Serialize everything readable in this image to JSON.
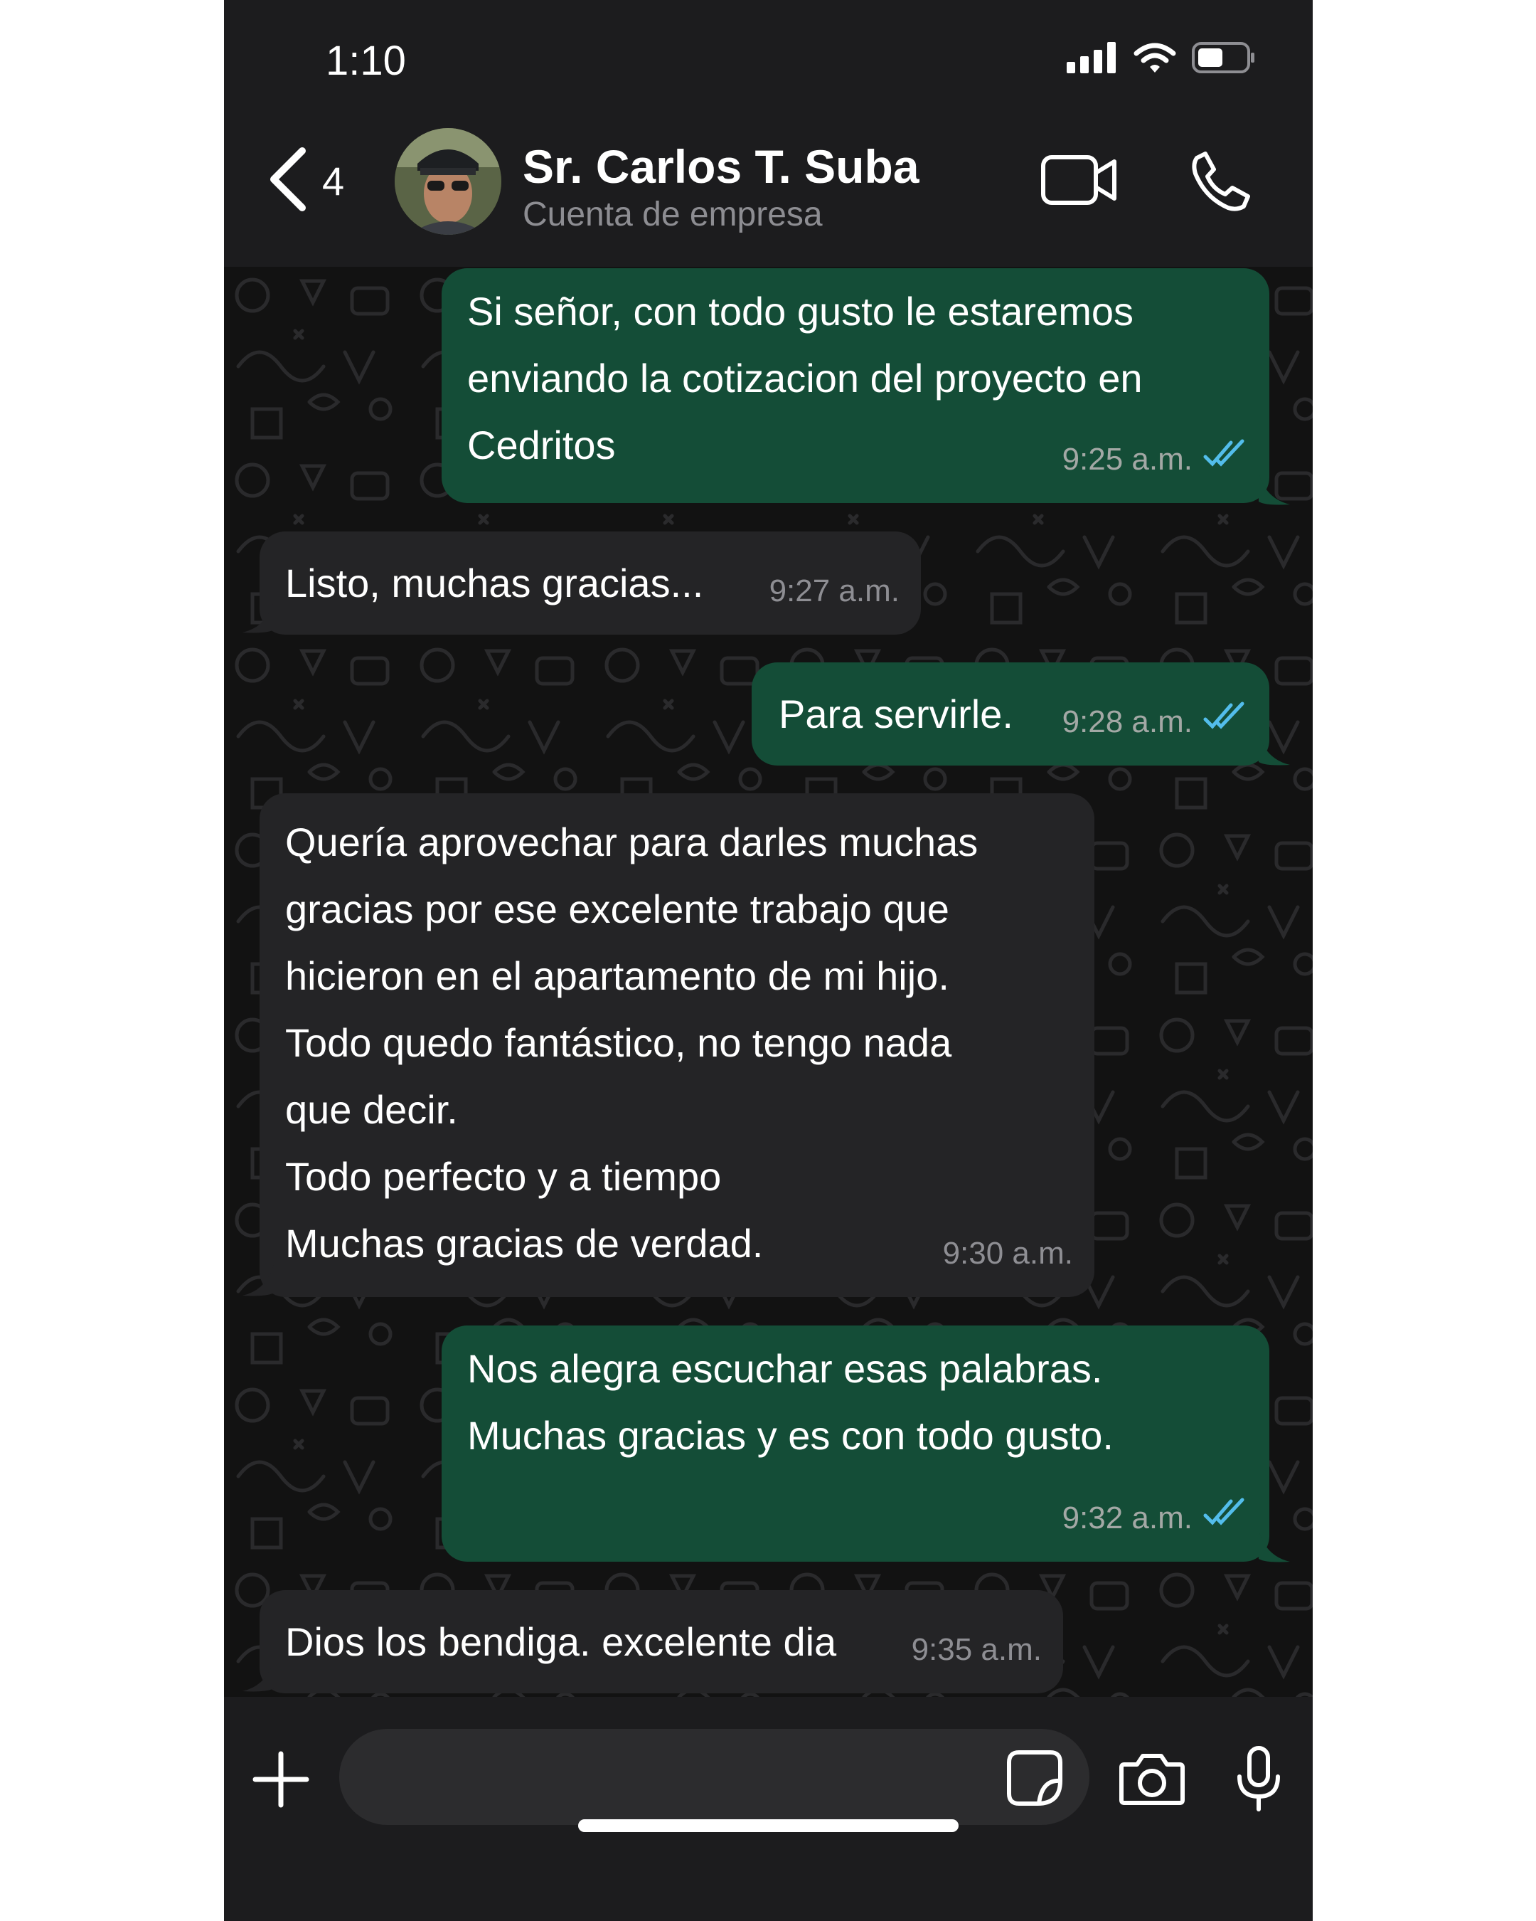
{
  "status_bar": {
    "time": "1:10"
  },
  "header": {
    "back_count": "4",
    "contact_name": "Sr. Carlos T. Suba",
    "contact_subtitle": "Cuenta de empresa",
    "back_icon": "chevron-left-icon",
    "video_icon": "video-camera-icon",
    "call_icon": "phone-icon"
  },
  "messages": [
    {
      "direction": "outgoing",
      "text": "Si señor, con todo gusto le estaremos\nenviando la cotizacion del proyecto en\nCedritos",
      "time": "9:25 a.m.",
      "read": true
    },
    {
      "direction": "incoming",
      "text": "Listo, muchas gracias...",
      "time": "9:27 a.m."
    },
    {
      "direction": "outgoing",
      "text": "Para servirle.",
      "time": "9:28 a.m.",
      "read": true
    },
    {
      "direction": "incoming",
      "text": "Quería aprovechar para darles muchas\ngracias por ese excelente trabajo que\nhicieron en el apartamento de mi hijo.\nTodo quedo fantástico, no tengo nada\nque decir.\nTodo perfecto y a tiempo\nMuchas gracias de verdad.",
      "time": "9:30 a.m."
    },
    {
      "direction": "outgoing",
      "text": "Nos alegra escuchar esas palabras.\nMuchas gracias y es con todo gusto.",
      "time": "9:32 a.m.",
      "read": true
    },
    {
      "direction": "incoming",
      "text": "Dios los bendiga. excelente dia",
      "time": "9:35 a.m."
    }
  ],
  "composer": {
    "placeholder": "",
    "icons": [
      "plus-icon",
      "sticker-icon",
      "camera-icon",
      "microphone-icon"
    ]
  },
  "colors": {
    "outgoing_bubble": "#144d37",
    "incoming_bubble": "#242426",
    "read_ticks": "#53bdeb",
    "chat_background": "#121212",
    "bar_background": "#1c1c1e"
  }
}
